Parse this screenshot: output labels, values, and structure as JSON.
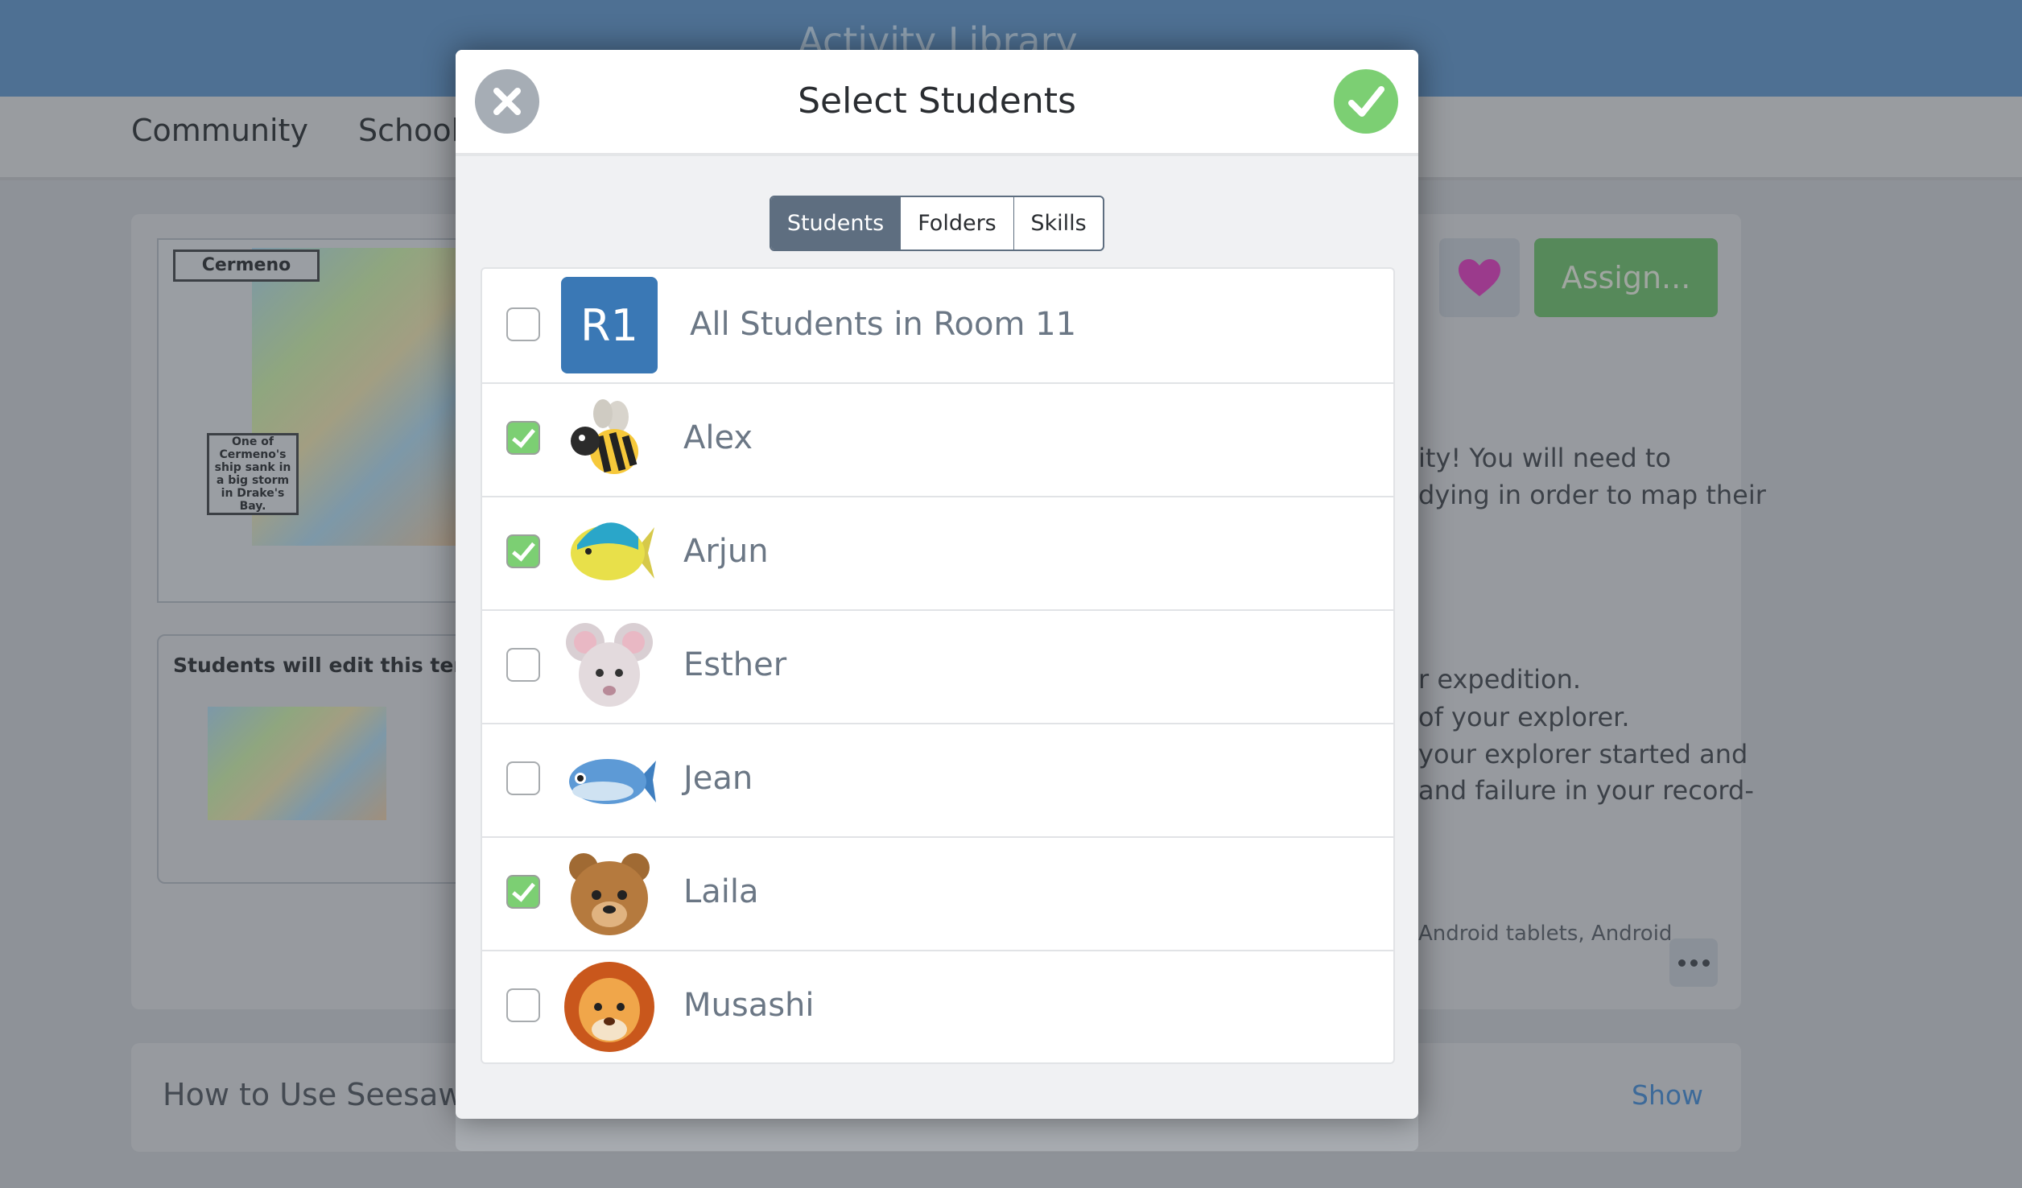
{
  "header": {
    "title": "Activity Library"
  },
  "nav": {
    "items": [
      "Community",
      "School"
    ]
  },
  "activity": {
    "image_labels": {
      "title": "Cermeno",
      "note": "One of Cermeno's ship sank in a big storm in Drake's Bay."
    },
    "template_caption": "Students will edit this templa",
    "favorite_icon": "heart-icon",
    "assign_label": "Assign...",
    "description_fragments": [
      "ity! You will need to",
      "dying in order to map their",
      "r expedition.",
      " of your explorer.",
      "your explorer started and",
      "and failure in your record-"
    ],
    "devices": "Android tablets, Android",
    "more_icon": "ellipsis-icon"
  },
  "howto": {
    "title": "How to Use Seesaw",
    "show_label": "Show"
  },
  "modal": {
    "title": "Select Students",
    "close_icon": "close-icon",
    "confirm_icon": "check-icon",
    "tabs": [
      {
        "label": "Students",
        "active": true
      },
      {
        "label": "Folders",
        "active": false
      },
      {
        "label": "Skills",
        "active": false
      }
    ],
    "rows": [
      {
        "name": "All Students in Room 11",
        "avatar": "R1",
        "checked": false
      },
      {
        "name": "Alex",
        "avatar": "bee",
        "checked": true
      },
      {
        "name": "Arjun",
        "avatar": "tropical-fish",
        "checked": true
      },
      {
        "name": "Esther",
        "avatar": "mouse",
        "checked": false
      },
      {
        "name": "Jean",
        "avatar": "fish",
        "checked": false
      },
      {
        "name": "Laila",
        "avatar": "bear",
        "checked": true
      },
      {
        "name": "Musashi",
        "avatar": "lion",
        "checked": false
      }
    ]
  },
  "colors": {
    "accent_blue": "#3a78b5",
    "confirm_green": "#7ccf73",
    "close_grey": "#a6adb5",
    "tab_active": "#5e6e80",
    "heart": "#9b3a8c",
    "assign_green": "#56895a"
  }
}
